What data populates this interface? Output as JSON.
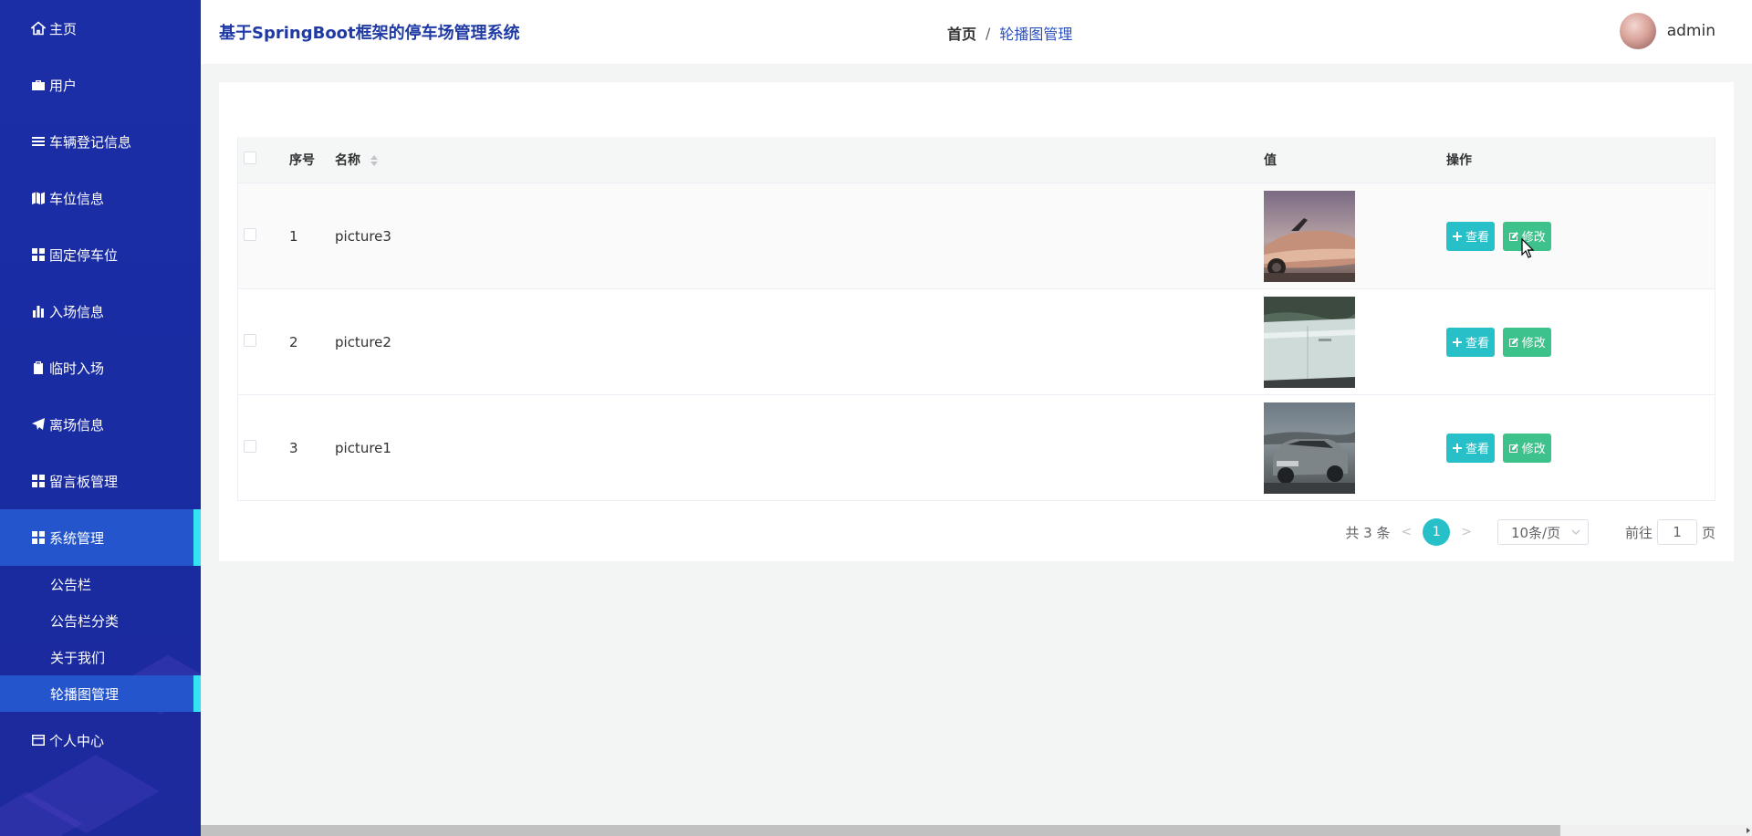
{
  "sidebar": {
    "items": [
      {
        "label": "主页",
        "icon": "home-icon"
      },
      {
        "label": "用户",
        "icon": "briefcase-icon"
      },
      {
        "label": "车辆登记信息",
        "icon": "list-icon"
      },
      {
        "label": "车位信息",
        "icon": "map-icon"
      },
      {
        "label": "固定停车位",
        "icon": "grid-icon"
      },
      {
        "label": "入场信息",
        "icon": "bar-chart-icon"
      },
      {
        "label": "临时入场",
        "icon": "clipboard-icon"
      },
      {
        "label": "离场信息",
        "icon": "paper-plane-icon"
      },
      {
        "label": "留言板管理",
        "icon": "grid-icon"
      },
      {
        "label": "系统管理",
        "icon": "grid-icon"
      }
    ],
    "sub_items": [
      {
        "label": "公告栏"
      },
      {
        "label": "公告栏分类"
      },
      {
        "label": "关于我们"
      },
      {
        "label": "轮播图管理"
      }
    ],
    "last_item": {
      "label": "个人中心",
      "icon": "card-icon"
    }
  },
  "header": {
    "title": "基于SpringBoot框架的停车场管理系统",
    "breadcrumb_home": "首页",
    "breadcrumb_sep": "/",
    "breadcrumb_current": "轮播图管理",
    "username": "admin"
  },
  "table": {
    "headers": {
      "index": "序号",
      "name": "名称",
      "value": "值",
      "actions": "操作"
    },
    "rows": [
      {
        "index": "1",
        "name": "picture3",
        "image": "pink-convertible-car"
      },
      {
        "index": "2",
        "name": "picture2",
        "image": "white-car-door-closeup"
      },
      {
        "index": "3",
        "name": "picture1",
        "image": "grey-suv-on-road"
      }
    ],
    "view_label": "查看",
    "edit_label": "修改"
  },
  "pagination": {
    "total": "共 3 条",
    "prev": "<",
    "current": "1",
    "next": ">",
    "page_size": "10条/页",
    "goto_prefix": "前往",
    "goto_value": "1",
    "goto_suffix": "页"
  },
  "colors": {
    "sidebar_bg": "#1b2ea6",
    "sidebar_active": "#2455cc",
    "active_marker": "#35e2f4",
    "view_button": "#28c0c8",
    "edit_button": "#3cc28a",
    "title_color": "#1f3aa4"
  }
}
